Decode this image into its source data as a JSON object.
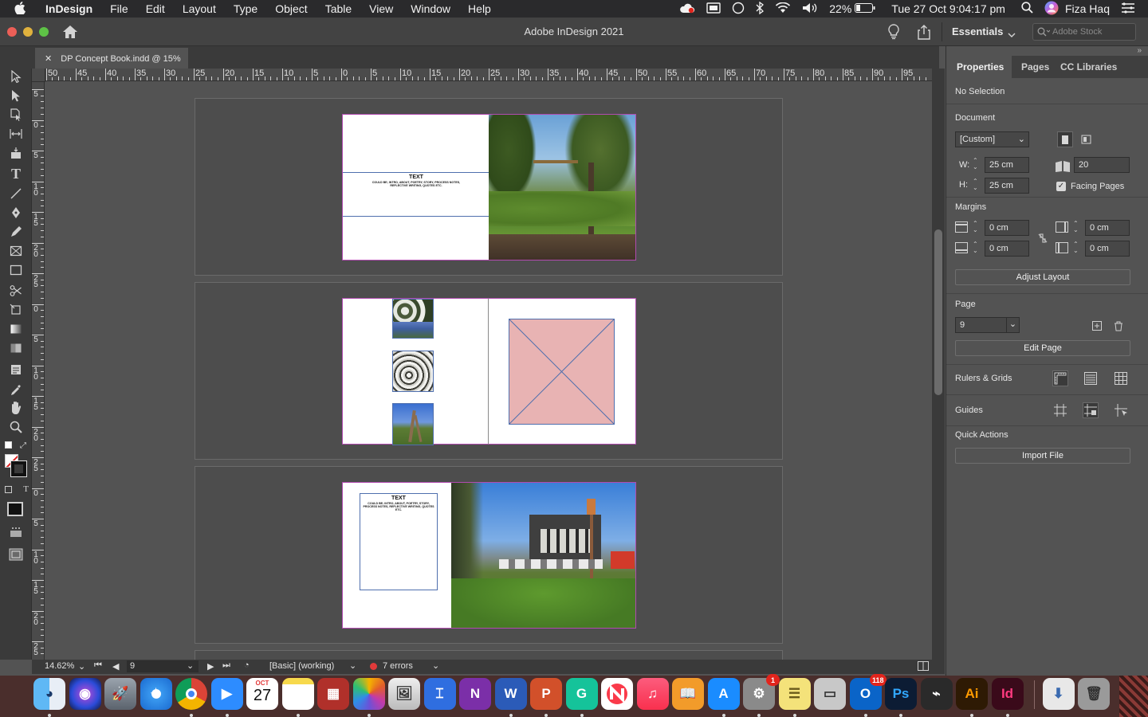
{
  "menubar": {
    "app_name": "InDesign",
    "items": [
      "File",
      "Edit",
      "Layout",
      "Type",
      "Object",
      "Table",
      "View",
      "Window",
      "Help"
    ],
    "battery": "22%",
    "clock": "Tue 27 Oct  9:04:17 pm",
    "user": "Fiza Haq"
  },
  "window": {
    "title": "Adobe InDesign 2021",
    "workspace": "Essentials",
    "stock_search_placeholder": "Adobe Stock"
  },
  "document_tab": {
    "label": "DP Concept Book.indd @ 15%"
  },
  "rulers": {
    "horizontal_labels": [
      "50",
      "45",
      "40",
      "35",
      "30",
      "25",
      "20",
      "15",
      "10",
      "5",
      "0",
      "5",
      "10",
      "15",
      "20",
      "25",
      "30",
      "35",
      "40",
      "45",
      "50",
      "55",
      "60",
      "65",
      "70",
      "75",
      "80",
      "85",
      "90",
      "95"
    ],
    "vertical_labels": [
      "5",
      "0",
      "5",
      "10",
      "15",
      "20",
      "25",
      "0",
      "5",
      "10",
      "15",
      "20",
      "25",
      "0",
      "5",
      "10",
      "15",
      "20",
      "25"
    ]
  },
  "spreads": [
    {
      "text_title": "TEXT",
      "text_body": "COULD BE; INTRO, ABOUT, POETRY, STORY, PROCESS NOTES, REFLECTIVE WRITING, QUOTES ETC."
    },
    {},
    {
      "text_title": "TEXT",
      "text_body": "COULD BE; INTRO, ABOUT, POETRY, STORY, PROCESS NOTES, REFLECTIVE WRITING, QUOTES ETC."
    }
  ],
  "status": {
    "zoom": "14.62%",
    "page": "9",
    "preflight_profile": "[Basic] (working)",
    "errors": "7 errors",
    "error_color": "#e03a3a"
  },
  "properties_panel": {
    "tabs": [
      "Properties",
      "Pages",
      "CC Libraries"
    ],
    "selection": "No Selection",
    "document_heading": "Document",
    "preset": "[Custom]",
    "width_label": "W:",
    "width": "25 cm",
    "height_label": "H:",
    "height": "25 cm",
    "pages_count": "20",
    "facing_pages_label": "Facing Pages",
    "facing_pages_checked": true,
    "margins_heading": "Margins",
    "margin_top": "0 cm",
    "margin_bottom": "0 cm",
    "margin_inside": "0 cm",
    "margin_outside": "0 cm",
    "adjust_layout": "Adjust Layout",
    "page_heading": "Page",
    "page_value": "9",
    "edit_page": "Edit Page",
    "rulers_grids": "Rulers & Grids",
    "guides": "Guides",
    "quick_actions": "Quick Actions",
    "import_file": "Import File"
  },
  "dock": {
    "items": [
      "Finder",
      "Siri",
      "Launchpad",
      "Safari",
      "Chrome",
      "Zoom",
      "Calendar",
      "Notes",
      "Photo Booth",
      "Photos",
      "Preview",
      "Keynote",
      "OneNote",
      "Word",
      "PowerPoint",
      "Grammarly",
      "News",
      "Music",
      "Books",
      "App Store",
      "System Preferences",
      "Stickies",
      "Image Capture",
      "Outlook",
      "Photoshop",
      "Acrobat",
      "Illustrator",
      "InDesign",
      "Downloads",
      "Trash"
    ],
    "calendar_month": "OCT",
    "calendar_day": "27",
    "system_prefs_badge": "1",
    "outlook_badge": "118"
  }
}
